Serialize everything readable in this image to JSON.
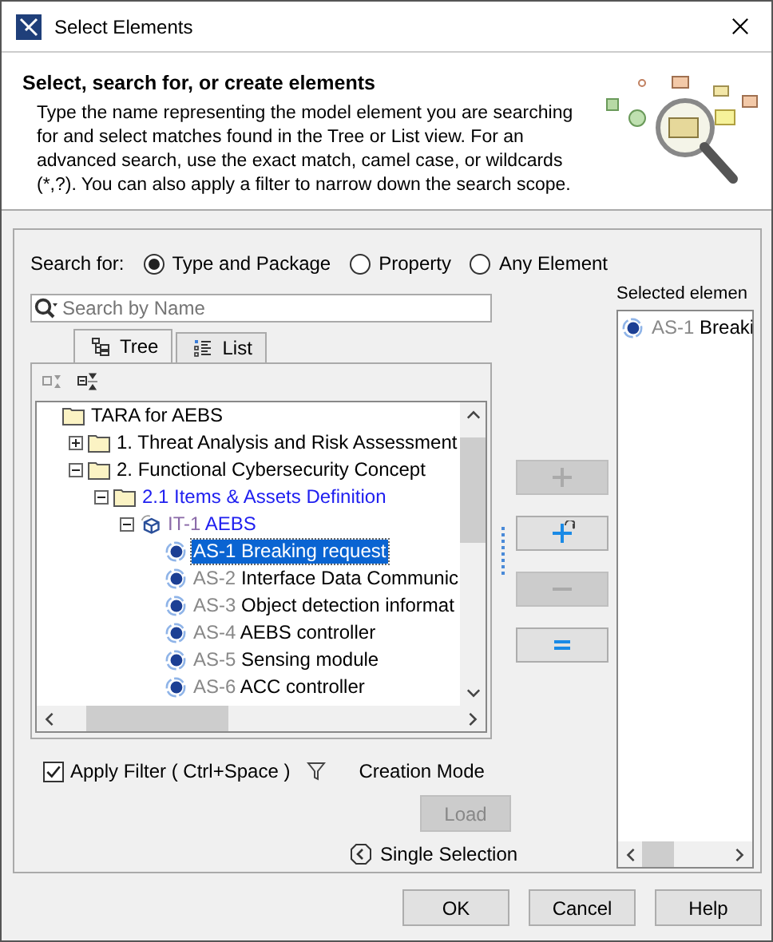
{
  "window": {
    "title": "Select Elements"
  },
  "header": {
    "title": "Select, search for, or create elements",
    "description": "Type the name representing the model element you are searching for and select matches found in the Tree or List view. For an advanced search, use the exact match, camel case, or wildcards (*,?). You can also apply a filter to narrow down the search scope."
  },
  "search_for": {
    "label": "Search for:",
    "options": [
      {
        "label": "Type and Package",
        "selected": true
      },
      {
        "label": "Property",
        "selected": false
      },
      {
        "label": "Any Element",
        "selected": false
      }
    ]
  },
  "search": {
    "placeholder": "Search by Name"
  },
  "tabs": [
    {
      "label": "Tree",
      "kind": "tree",
      "selected": true
    },
    {
      "label": "List",
      "kind": "list",
      "selected": false
    }
  ],
  "tree": [
    {
      "kind": "folder",
      "label": "TARA for AEBS",
      "children": [
        {
          "kind": "folder",
          "label": "1. Threat Analysis and Risk Assessment",
          "expanded": false
        },
        {
          "kind": "folder",
          "label": "2. Functional Cybersecurity Concept",
          "expanded": true,
          "children": [
            {
              "kind": "package",
              "label": "2.1 Items & Assets Definition",
              "expanded": true,
              "children": [
                {
                  "kind": "block",
                  "id": "IT-1",
                  "label": "AEBS",
                  "expanded": true,
                  "children": [
                    {
                      "kind": "asset",
                      "id": "AS-1",
                      "label": "Breaking request",
                      "selected": true
                    },
                    {
                      "kind": "asset",
                      "id": "AS-2",
                      "label": " Interface Data Communic",
                      "selected": false
                    },
                    {
                      "kind": "asset",
                      "id": "AS-3",
                      "label": "Object detection informat",
                      "selected": false
                    },
                    {
                      "kind": "asset",
                      "id": "AS-4",
                      "label": "AEBS controller",
                      "selected": false
                    },
                    {
                      "kind": "asset",
                      "id": "AS-5",
                      "label": "Sensing module",
                      "selected": false
                    },
                    {
                      "kind": "asset",
                      "id": "AS-6",
                      "label": "ACC controller",
                      "selected": false
                    }
                  ]
                }
              ]
            }
          ]
        }
      ]
    }
  ],
  "transfer_buttons": [
    {
      "kind": "add",
      "disabled": true
    },
    {
      "kind": "add_recursive",
      "disabled": false
    },
    {
      "kind": "remove",
      "disabled": true
    },
    {
      "kind": "remove_all",
      "disabled": false
    }
  ],
  "apply_filter": {
    "label": "Apply Filter ( Ctrl+Space )",
    "checked": true
  },
  "creation_mode": "Creation Mode",
  "load_button": {
    "label": "Load",
    "disabled": true
  },
  "single_selection": "Single Selection",
  "selected_elements": {
    "label": "Selected elemen",
    "items": [
      {
        "id": "AS-1",
        "label": "Breaki"
      }
    ]
  },
  "buttons": [
    "OK",
    "Cancel",
    "Help"
  ]
}
